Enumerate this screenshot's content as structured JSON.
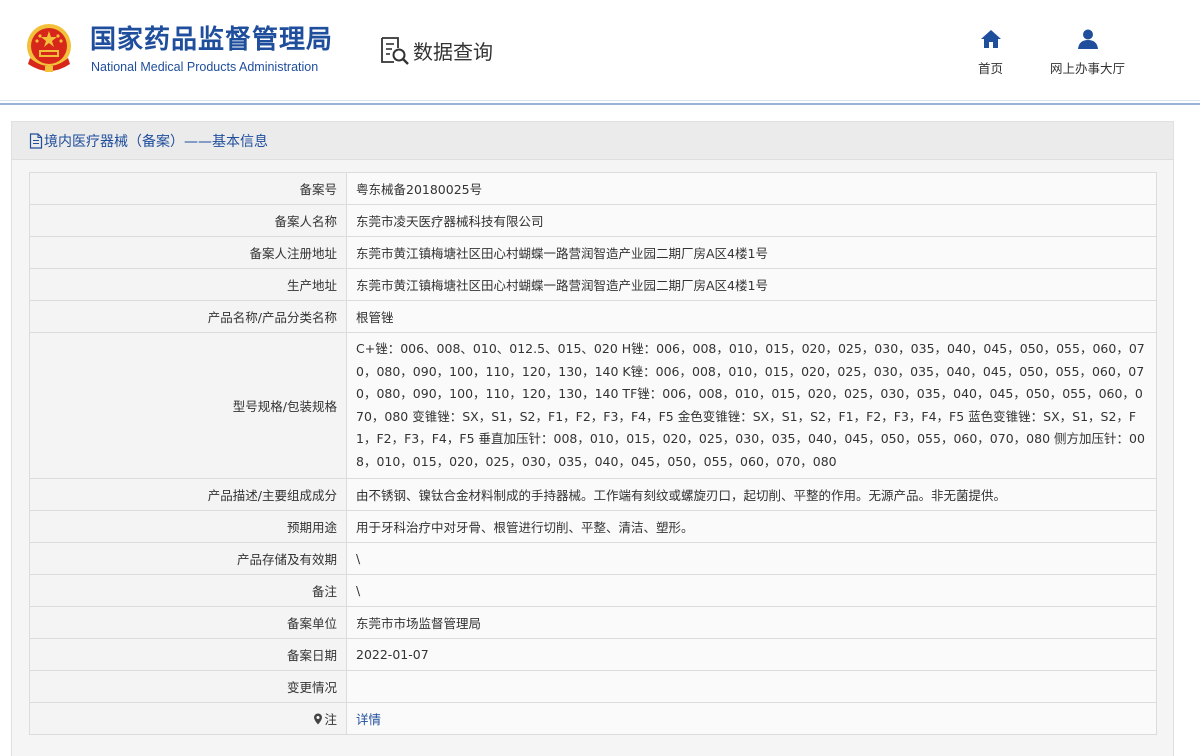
{
  "header": {
    "org_name_cn": "国家药品监督管理局",
    "org_name_en": "National Medical Products Administration",
    "section_title": "数据查询",
    "nav": [
      {
        "label": "首页",
        "icon": "home-icon"
      },
      {
        "label": "网上办事大厅",
        "icon": "user-icon"
      }
    ],
    "colors": {
      "brand": "#1f4e9c",
      "emblem_red": "#d7261a",
      "emblem_gold": "#f3c03a"
    }
  },
  "panel": {
    "title": "境内医疗器械（备案）——基本信息",
    "icon": "document-icon"
  },
  "rows": [
    {
      "label": "备案号",
      "value": "粤东械备20180025号"
    },
    {
      "label": "备案人名称",
      "value": "东莞市凌天医疗器械科技有限公司"
    },
    {
      "label": "备案人注册地址",
      "value": "东莞市黄江镇梅塘社区田心村蝴蝶一路营润智造产业园二期厂房A区4楼1号"
    },
    {
      "label": "生产地址",
      "value": "东莞市黄江镇梅塘社区田心村蝴蝶一路营润智造产业园二期厂房A区4楼1号"
    },
    {
      "label": "产品名称/产品分类名称",
      "value": "根管锉"
    },
    {
      "label": "型号规格/包装规格",
      "value": "C+锉：006、008、010、012.5、015、020 H锉：006，008，010，015，020，025，030，035，040，045，050，055，060，070，080，090，100，110，120，130，140 K锉：006，008，010，015，020，025，030，035，040，045，050，055，060，070，080，090，100，110，120，130，140 TF锉：006，008，010，015，020，025，030，035，040，045，050，055，060，070，080 变锥锉：SX，S1，S2，F1，F2，F3，F4，F5 金色变锥锉：SX，S1，S2，F1，F2，F3，F4，F5 蓝色变锥锉：SX，S1，S2，F1，F2，F3，F4，F5 垂直加压针：008，010，015，020，025，030，035，040，045，050，055，060，070，080 侧方加压针：008，010，015，020，025，030，035，040，045，050，055，060，070，080"
    },
    {
      "label": "产品描述/主要组成成分",
      "value": "由不锈钢、镍钛合金材料制成的手持器械。工作端有刻纹或螺旋刃口，起切削、平整的作用。无源产品。非无菌提供。"
    },
    {
      "label": "预期用途",
      "value": "用于牙科治疗中对牙骨、根管进行切削、平整、清洁、塑形。"
    },
    {
      "label": "产品存储及有效期",
      "value": "\\"
    },
    {
      "label": "备注",
      "value": "\\"
    },
    {
      "label": "备案单位",
      "value": "东莞市市场监督管理局"
    },
    {
      "label": "备案日期",
      "value": "2022-01-07"
    },
    {
      "label": "变更情况",
      "value": ""
    }
  ],
  "note_row": {
    "label": "注",
    "link_text": "详情",
    "icon": "pin-icon"
  }
}
